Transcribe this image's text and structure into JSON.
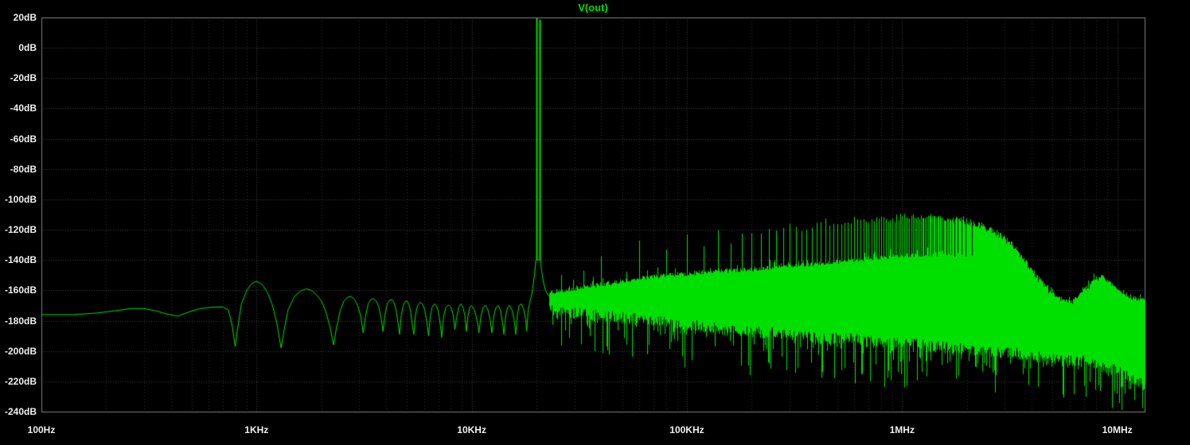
{
  "colors": {
    "background": "#000000",
    "border": "#828282",
    "grid_major": "#3d433d",
    "grid_minor": "#2b312b",
    "trace": "#00e000",
    "title_color": "#00dc00",
    "axis_label": "#f0f0f0"
  },
  "chart_data": {
    "type": "line",
    "title": "V(out)",
    "legend": [
      "V(out)"
    ],
    "x_axis": {
      "scale": "log",
      "unit": "Hz",
      "min_hz": 100,
      "max_hz": 13400000,
      "ticks": [
        {
          "hz": 100,
          "label": "100Hz"
        },
        {
          "hz": 1000,
          "label": "1KHz"
        },
        {
          "hz": 10000,
          "label": "10KHz"
        },
        {
          "hz": 100000,
          "label": "100KHz"
        },
        {
          "hz": 1000000,
          "label": "1MHz"
        },
        {
          "hz": 10000000,
          "label": "10MHz"
        }
      ]
    },
    "y_axis": {
      "unit": "dB",
      "max_db": 20,
      "min_db": -240,
      "step_db": 20,
      "ticks": [
        {
          "db": 20,
          "label": "20dB"
        },
        {
          "db": 0,
          "label": "0dB"
        },
        {
          "db": -20,
          "label": "-20dB"
        },
        {
          "db": -40,
          "label": "-40dB"
        },
        {
          "db": -60,
          "label": "-60dB"
        },
        {
          "db": -80,
          "label": "-80dB"
        },
        {
          "db": -100,
          "label": "-100dB"
        },
        {
          "db": -120,
          "label": "-120dB"
        },
        {
          "db": -140,
          "label": "-140dB"
        },
        {
          "db": -160,
          "label": "-160dB"
        },
        {
          "db": -180,
          "label": "-180dB"
        },
        {
          "db": -200,
          "label": "-200dB"
        },
        {
          "db": -220,
          "label": "-220dB"
        },
        {
          "db": -240,
          "label": "-240dB"
        }
      ]
    },
    "series": [
      {
        "name": "V(out)",
        "color": "#00e000"
      }
    ],
    "fundamental_spikes": [
      {
        "f": 20000,
        "peak_db": 19.5,
        "base_db": -140
      },
      {
        "f": 20600,
        "peak_db": 18.5,
        "base_db": -140
      }
    ],
    "line_points": [
      [
        100,
        -176
      ],
      [
        140,
        -176
      ],
      [
        180,
        -175
      ],
      [
        220,
        -173.5
      ],
      [
        260,
        -172
      ],
      [
        300,
        -172
      ],
      [
        340,
        -173.5
      ],
      [
        380,
        -175.5
      ],
      [
        430,
        -177
      ],
      [
        480,
        -174.5
      ],
      [
        530,
        -172.5
      ],
      [
        580,
        -171.5
      ],
      [
        640,
        -171
      ],
      [
        700,
        -171
      ],
      [
        740,
        -173
      ],
      [
        770,
        -183
      ],
      [
        795,
        -197
      ],
      [
        815,
        -186
      ],
      [
        850,
        -169
      ],
      [
        900,
        -160
      ],
      [
        950,
        -155.5
      ],
      [
        1000,
        -154
      ],
      [
        1060,
        -156
      ],
      [
        1120,
        -161
      ],
      [
        1180,
        -169
      ],
      [
        1240,
        -181
      ],
      [
        1300,
        -198
      ],
      [
        1340,
        -187
      ],
      [
        1400,
        -173
      ],
      [
        1500,
        -164
      ],
      [
        1600,
        -160.5
      ],
      [
        1700,
        -159
      ],
      [
        1800,
        -160
      ],
      [
        1900,
        -163
      ],
      [
        2000,
        -167
      ],
      [
        2100,
        -174
      ],
      [
        2200,
        -185
      ],
      [
        2280,
        -196
      ],
      [
        2350,
        -185
      ],
      [
        2450,
        -173
      ],
      [
        2550,
        -167
      ],
      [
        2650,
        -164.5
      ],
      [
        2750,
        -164
      ],
      [
        2850,
        -166
      ],
      [
        2950,
        -170
      ],
      [
        3050,
        -177
      ],
      [
        3130,
        -188
      ],
      [
        3200,
        -178
      ],
      [
        3300,
        -169
      ],
      [
        3400,
        -166
      ],
      [
        3500,
        -165.5
      ],
      [
        3600,
        -167
      ],
      [
        3700,
        -171
      ],
      [
        3800,
        -179
      ],
      [
        3870,
        -187
      ],
      [
        3950,
        -176
      ],
      [
        4050,
        -169
      ],
      [
        4150,
        -166.5
      ],
      [
        4250,
        -166
      ],
      [
        4350,
        -168
      ],
      [
        4450,
        -173
      ],
      [
        4550,
        -182
      ],
      [
        4620,
        -189
      ],
      [
        4700,
        -177
      ],
      [
        4800,
        -170
      ],
      [
        4900,
        -167.5
      ],
      [
        5000,
        -167
      ],
      [
        5100,
        -169
      ],
      [
        5200,
        -174
      ],
      [
        5300,
        -183
      ],
      [
        5380,
        -189
      ],
      [
        5480,
        -176
      ],
      [
        5600,
        -170
      ],
      [
        5750,
        -168
      ],
      [
        5900,
        -169
      ],
      [
        6050,
        -173
      ],
      [
        6200,
        -182
      ],
      [
        6300,
        -190
      ],
      [
        6420,
        -177
      ],
      [
        6550,
        -171
      ],
      [
        6700,
        -169
      ],
      [
        6850,
        -170
      ],
      [
        7000,
        -174
      ],
      [
        7150,
        -183
      ],
      [
        7250,
        -191
      ],
      [
        7400,
        -177
      ],
      [
        7600,
        -171
      ],
      [
        7800,
        -169.5
      ],
      [
        8000,
        -171
      ],
      [
        8200,
        -176
      ],
      [
        8350,
        -186
      ],
      [
        8500,
        -178
      ],
      [
        8700,
        -171
      ],
      [
        8900,
        -169
      ],
      [
        9100,
        -171
      ],
      [
        9300,
        -177
      ],
      [
        9450,
        -187
      ],
      [
        9600,
        -177
      ],
      [
        9800,
        -171
      ],
      [
        10000,
        -170
      ],
      [
        10300,
        -173
      ],
      [
        10600,
        -180
      ],
      [
        10800,
        -188
      ],
      [
        11000,
        -178
      ],
      [
        11300,
        -171
      ],
      [
        11600,
        -170
      ],
      [
        11900,
        -173
      ],
      [
        12200,
        -180
      ],
      [
        12400,
        -188
      ],
      [
        12700,
        -176
      ],
      [
        13000,
        -171
      ],
      [
        13300,
        -170
      ],
      [
        13600,
        -173
      ],
      [
        13900,
        -181
      ],
      [
        14100,
        -189
      ],
      [
        14400,
        -176
      ],
      [
        14700,
        -171
      ],
      [
        15000,
        -170
      ],
      [
        15400,
        -173
      ],
      [
        15800,
        -181
      ],
      [
        16000,
        -189
      ],
      [
        16300,
        -176
      ],
      [
        16600,
        -170
      ],
      [
        17000,
        -169
      ],
      [
        17400,
        -172
      ],
      [
        17800,
        -179
      ],
      [
        18000,
        -187
      ],
      [
        18300,
        -173
      ],
      [
        18600,
        -168
      ],
      [
        18900,
        -164
      ],
      [
        19200,
        -159
      ],
      [
        19400,
        -154
      ],
      [
        19600,
        -149
      ],
      [
        19750,
        -144
      ],
      [
        19850,
        -140
      ],
      [
        20850,
        -140
      ],
      [
        21100,
        -147
      ],
      [
        21500,
        -154
      ],
      [
        22000,
        -160
      ],
      [
        22600,
        -163
      ],
      [
        23000,
        -164
      ]
    ],
    "band": {
      "start_hz": 23000,
      "upper": [
        [
          23000,
          -161
        ],
        [
          30000,
          -159
        ],
        [
          40000,
          -156
        ],
        [
          60000,
          -152
        ],
        [
          80000,
          -150
        ],
        [
          100000,
          -149
        ],
        [
          150000,
          -147
        ],
        [
          200000,
          -146
        ],
        [
          300000,
          -144
        ],
        [
          500000,
          -141
        ],
        [
          700000,
          -139
        ],
        [
          1000000,
          -137
        ],
        [
          1500000,
          -136
        ],
        [
          2000000,
          -137
        ],
        [
          2500000,
          -141
        ],
        [
          3000000,
          -146
        ],
        [
          3500000,
          -151
        ],
        [
          4000000,
          -156
        ],
        [
          4500000,
          -160
        ],
        [
          5000000,
          -164
        ],
        [
          5500000,
          -167
        ],
        [
          6000000,
          -169
        ],
        [
          6500000,
          -166
        ],
        [
          7000000,
          -161
        ],
        [
          7500000,
          -158
        ],
        [
          8000000,
          -156
        ],
        [
          8500000,
          -156
        ],
        [
          9000000,
          -158
        ],
        [
          9500000,
          -160
        ],
        [
          10000000,
          -162
        ],
        [
          11000000,
          -164
        ],
        [
          12000000,
          -165
        ],
        [
          13400000,
          -166
        ]
      ],
      "lower": [
        [
          23000,
          -173
        ],
        [
          30000,
          -175
        ],
        [
          40000,
          -177
        ],
        [
          60000,
          -179
        ],
        [
          100000,
          -183
        ],
        [
          200000,
          -187
        ],
        [
          400000,
          -191
        ],
        [
          700000,
          -193
        ],
        [
          1000000,
          -195
        ],
        [
          2000000,
          -199
        ],
        [
          3000000,
          -201
        ],
        [
          5000000,
          -205
        ],
        [
          7000000,
          -207
        ],
        [
          10000000,
          -213
        ],
        [
          13400000,
          -222
        ]
      ],
      "whisker_floor": [
        [
          23000,
          -200
        ],
        [
          100000,
          -212
        ],
        [
          500000,
          -222
        ],
        [
          2000000,
          -230
        ],
        [
          8000000,
          -236
        ],
        [
          13400000,
          -240
        ]
      ]
    },
    "comb": {
      "base_hz": 20000,
      "envelope": [
        [
          40000,
          -137
        ],
        [
          60000,
          -125
        ],
        [
          80000,
          -134
        ],
        [
          100000,
          -123
        ],
        [
          120000,
          -129
        ],
        [
          140000,
          -122
        ],
        [
          160000,
          -131
        ],
        [
          180000,
          -124
        ],
        [
          200000,
          -120
        ],
        [
          250000,
          -122
        ],
        [
          300000,
          -117
        ],
        [
          350000,
          -119
        ],
        [
          400000,
          -115
        ],
        [
          500000,
          -115
        ],
        [
          600000,
          -113
        ],
        [
          700000,
          -114
        ],
        [
          800000,
          -112
        ],
        [
          900000,
          -113
        ],
        [
          1000000,
          -111
        ],
        [
          1200000,
          -112
        ],
        [
          1400000,
          -111
        ],
        [
          1600000,
          -112
        ],
        [
          1800000,
          -113
        ],
        [
          2000000,
          -114
        ],
        [
          2200000,
          -116
        ],
        [
          2500000,
          -119
        ],
        [
          2800000,
          -123
        ],
        [
          3100000,
          -128
        ],
        [
          3400000,
          -134
        ],
        [
          3700000,
          -141
        ],
        [
          4000000,
          -147
        ],
        [
          4300000,
          -153
        ],
        [
          4600000,
          -158
        ],
        [
          5000000,
          -163
        ],
        [
          5500000,
          -167
        ],
        [
          6000000,
          -169
        ],
        [
          6500000,
          -166
        ],
        [
          7000000,
          -161
        ],
        [
          7500000,
          -157
        ],
        [
          8000000,
          -153
        ],
        [
          8500000,
          -152
        ],
        [
          9000000,
          -155
        ],
        [
          10000000,
          -161
        ],
        [
          11000000,
          -166
        ],
        [
          12000000,
          -169
        ],
        [
          13400000,
          -172
        ]
      ]
    },
    "extra_spikes": [
      {
        "f": 26000,
        "db": -150
      },
      {
        "f": 29500,
        "db": -153
      },
      {
        "f": 33000,
        "db": -147
      },
      {
        "f": 36500,
        "db": -151
      },
      {
        "f": 7800000,
        "db": -149
      }
    ]
  }
}
